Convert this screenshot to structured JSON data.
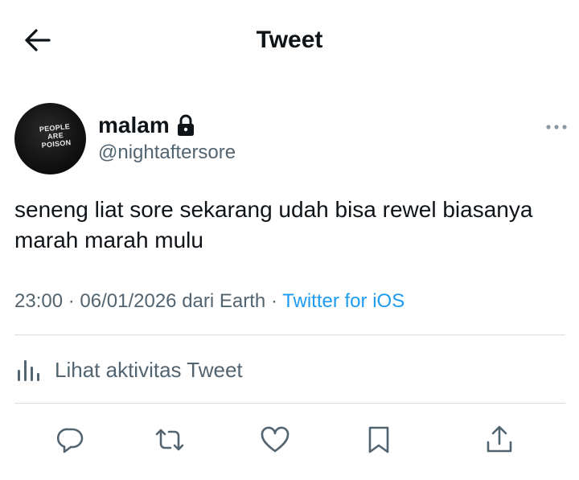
{
  "header": {
    "title": "Tweet",
    "back_icon": "arrow-left-icon"
  },
  "author": {
    "display_name": "malam",
    "handle": "@nightaftersore",
    "protected_icon": "lock-icon",
    "avatar": {
      "lines": [
        "PEOPLE",
        "ARE",
        "POISON"
      ]
    }
  },
  "tweet": {
    "text": "seneng liat sore sekarang udah bisa rewel biasanya marah marah mulu",
    "time": "23:00",
    "date": "06/01/2026",
    "location": "dari Earth",
    "separator": "·",
    "source": "Twitter for iOS"
  },
  "activity": {
    "label": "Lihat aktivitas Tweet",
    "icon": "analytics-bar-icon"
  },
  "actions": {
    "reply_icon": "reply-icon",
    "retweet_icon": "retweet-icon",
    "like_icon": "heart-icon",
    "bookmark_icon": "bookmark-icon",
    "share_icon": "share-icon"
  },
  "colors": {
    "text": "#0f1419",
    "secondary": "#536471",
    "link": "#1d9bf0",
    "divider": "#d9dde0"
  }
}
